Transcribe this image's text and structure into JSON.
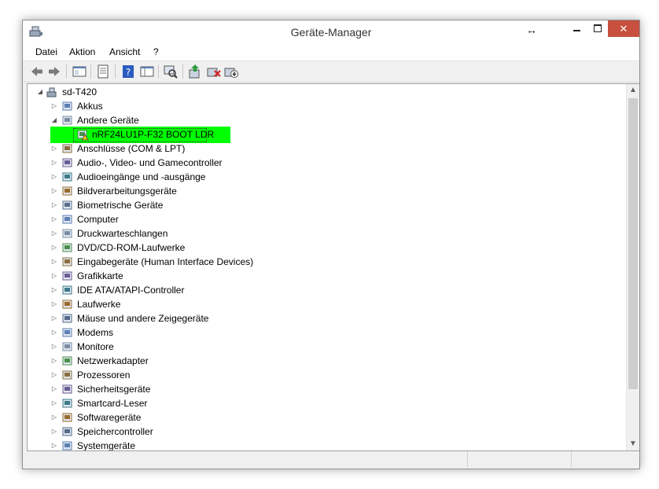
{
  "window": {
    "title": "Geräte-Manager",
    "resize_symbol": "↔",
    "close_symbol": "✕"
  },
  "menu": {
    "items": [
      "Datei",
      "Aktion",
      "Ansicht",
      "?"
    ]
  },
  "toolbar": {
    "buttons": [
      "back-arrow-icon",
      "forward-arrow-icon",
      "show-hide-console-tree-icon",
      "properties-icon",
      "help-icon",
      "view-icon",
      "scan-hardware-icon",
      "update-driver-icon",
      "uninstall-icon",
      "disable-device-icon"
    ]
  },
  "tree": {
    "root": "sd-T420",
    "items": [
      {
        "label": "Akkus",
        "icon": "battery-icon",
        "expanded": false
      },
      {
        "label": "Andere Geräte",
        "icon": "unknown-device-icon",
        "expanded": true
      },
      {
        "label": "nRF24LU1P-F32 BOOT LDR",
        "icon": "warning-device-icon",
        "child": true,
        "highlighted": true
      },
      {
        "label": "Anschlüsse (COM & LPT)",
        "icon": "port-icon",
        "expanded": false
      },
      {
        "label": "Audio-, Video- und Gamecontroller",
        "icon": "speaker-icon",
        "expanded": false
      },
      {
        "label": "Audioeingänge und -ausgänge",
        "icon": "speaker-icon",
        "expanded": false
      },
      {
        "label": "Bildverarbeitungsgeräte",
        "icon": "camera-icon",
        "expanded": false
      },
      {
        "label": "Biometrische Geräte",
        "icon": "fingerprint-icon",
        "expanded": false
      },
      {
        "label": "Computer",
        "icon": "computer-icon",
        "expanded": false
      },
      {
        "label": "Druckwarteschlangen",
        "icon": "printer-icon",
        "expanded": false
      },
      {
        "label": "DVD/CD-ROM-Laufwerke",
        "icon": "disc-drive-icon",
        "expanded": false
      },
      {
        "label": "Eingabegeräte (Human Interface Devices)",
        "icon": "hid-icon",
        "expanded": false
      },
      {
        "label": "Grafikkarte",
        "icon": "display-adapter-icon",
        "expanded": false
      },
      {
        "label": "IDE ATA/ATAPI-Controller",
        "icon": "ide-controller-icon",
        "expanded": false
      },
      {
        "label": "Laufwerke",
        "icon": "disk-drive-icon",
        "expanded": false
      },
      {
        "label": "Mäuse und andere Zeigegeräte",
        "icon": "mouse-icon",
        "expanded": false
      },
      {
        "label": "Modems",
        "icon": "modem-icon",
        "expanded": false
      },
      {
        "label": "Monitore",
        "icon": "monitor-icon",
        "expanded": false
      },
      {
        "label": "Netzwerkadapter",
        "icon": "network-adapter-icon",
        "expanded": false
      },
      {
        "label": "Prozessoren",
        "icon": "processor-icon",
        "expanded": false
      },
      {
        "label": "Sicherheitsgeräte",
        "icon": "security-key-icon",
        "expanded": false
      },
      {
        "label": "Smartcard-Leser",
        "icon": "smartcard-reader-icon",
        "expanded": false
      },
      {
        "label": "Softwaregeräte",
        "icon": "software-device-icon",
        "expanded": false
      },
      {
        "label": "Speichercontroller",
        "icon": "storage-controller-icon",
        "expanded": false
      },
      {
        "label": "Systemgeräte",
        "icon": "system-device-icon",
        "expanded": false
      }
    ]
  },
  "colors": {
    "highlight": "#00ff00",
    "close_button": "#c7503f"
  }
}
